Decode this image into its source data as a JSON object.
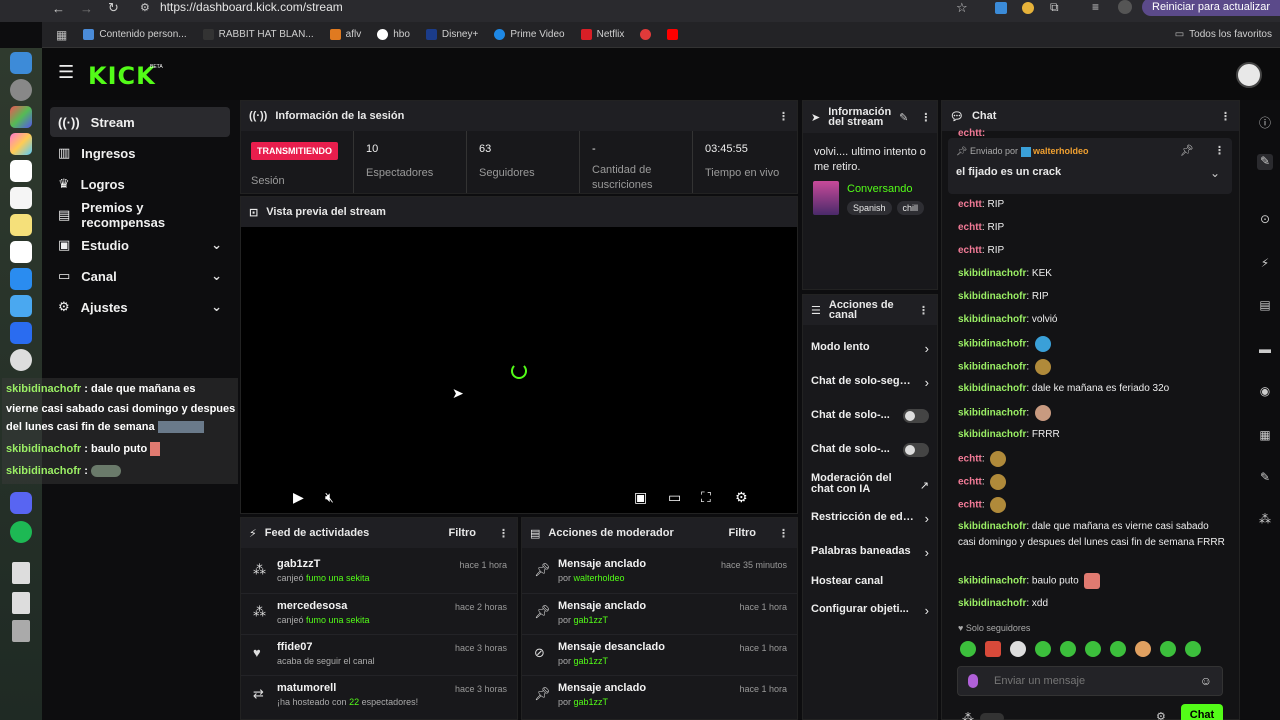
{
  "browser": {
    "url": "https://dashboard.kick.com/stream",
    "restart_label": "Reiniciar para actualizar",
    "bookmarks": [
      "Contenido person...",
      "RABBIT HAT BLAN...",
      "aflv",
      "hbo",
      "Disney+",
      "Prime Video",
      "Netflix"
    ],
    "all_favorites": "Todos los favoritos"
  },
  "brand": {
    "logo": "KICK",
    "beta": "BETA",
    "accent": "#53fc18"
  },
  "sidebar": {
    "items": [
      {
        "label": "Stream",
        "icon": "broadcast-icon",
        "active": true
      },
      {
        "label": "Ingresos",
        "icon": "chart-icon"
      },
      {
        "label": "Logros",
        "icon": "trophy-icon"
      },
      {
        "label": "Premios y recompensas",
        "icon": "gift-icon"
      },
      {
        "label": "Estudio",
        "icon": "monitor-icon",
        "expandable": true
      },
      {
        "label": "Canal",
        "icon": "display-icon",
        "expandable": true
      },
      {
        "label": "Ajustes",
        "icon": "gear-icon",
        "expandable": true
      }
    ]
  },
  "overlay_chat": {
    "lines": [
      {
        "user": "skibidinachofr",
        "text": "dale que mañana es"
      },
      {
        "user": "",
        "text": "vierne casi sabado casi domingo y despues"
      },
      {
        "user": "",
        "text": "del lunes casi fin de semana"
      },
      {
        "user": "skibidinachofr",
        "text": "baulo puto"
      },
      {
        "user": "skibidinachofr",
        "text": ""
      }
    ]
  },
  "session": {
    "title": "Información de la sesión",
    "status": "TRANSMITIENDO",
    "status_label": "Sesión",
    "stats": [
      {
        "value": "10",
        "label": "Espectadores"
      },
      {
        "value": "63",
        "label": "Seguidores"
      },
      {
        "value": "-",
        "label": "Cantidad de suscriciones"
      },
      {
        "value": "03:45:55",
        "label": "Tiempo en vivo"
      }
    ]
  },
  "preview": {
    "title": "Vista previa del stream"
  },
  "stream_info": {
    "title": "Información del stream",
    "stream_title": "volvi.... ultimo intento o me retiro.",
    "category": "Conversando",
    "tags": [
      "Spanish",
      "chill"
    ]
  },
  "channel_actions": {
    "title": "Acciones de canal",
    "items": [
      {
        "label": "Modo lento",
        "type": "chevron"
      },
      {
        "label": "Chat de solo-seguidores",
        "type": "chevron"
      },
      {
        "label": "Chat de solo-...",
        "type": "toggle"
      },
      {
        "label": "Chat de solo-...",
        "type": "toggle"
      },
      {
        "label": "Moderación del chat con IA",
        "type": "external"
      },
      {
        "label": "Restricción de edad",
        "type": "chevron"
      },
      {
        "label": "Palabras baneadas",
        "type": "chevron"
      },
      {
        "label": "Hostear canal",
        "type": "none"
      },
      {
        "label": "Configurar objeti...",
        "type": "chevron"
      }
    ]
  },
  "activity_feed": {
    "title": "Feed de actividades",
    "filter": "Filtro",
    "rows": [
      {
        "name": "gab1zzT",
        "pre": "canjeó ",
        "highlight": "fumo una sekita",
        "post": "",
        "time": "hace 1 hora",
        "icon": "redeem-icon"
      },
      {
        "name": "mercedesosa",
        "pre": "canjeó ",
        "highlight": "fumo una sekita",
        "post": "",
        "time": "hace 2 horas",
        "icon": "redeem-icon"
      },
      {
        "name": "ffide07",
        "pre": "acaba de seguir el canal",
        "highlight": "",
        "post": "",
        "time": "hace 3 horas",
        "icon": "heart-icon"
      },
      {
        "name": "matumorell",
        "pre": "¡ha hosteado con ",
        "highlight": "22",
        "post": " espectadores!",
        "time": "hace 3 horas",
        "icon": "host-icon"
      }
    ]
  },
  "mod_actions": {
    "title": "Acciones de moderador",
    "filter": "Filtro",
    "rows": [
      {
        "action": "Mensaje anclado",
        "by": "por ",
        "user": "walterholdeo",
        "time": "hace 35 minutos",
        "icon": "pin-icon"
      },
      {
        "action": "Mensaje anclado",
        "by": "por ",
        "user": "gab1zzT",
        "time": "hace 1 hora",
        "icon": "pin-icon"
      },
      {
        "action": "Mensaje desanclado",
        "by": "por ",
        "user": "gab1zzT",
        "time": "hace 1 hora",
        "icon": "unpin-icon"
      },
      {
        "action": "Mensaje anclado",
        "by": "por ",
        "user": "gab1zzT",
        "time": "hace 1 hora",
        "icon": "pin-icon"
      }
    ]
  },
  "chat": {
    "title": "Chat",
    "pinned": {
      "sent_by": "Enviado por",
      "user": "walterholdeo",
      "message": "el fijado es un crack"
    },
    "top_partial_user": "echtt:",
    "messages": [
      {
        "user": "echtt",
        "color": "p",
        "text": "RIP"
      },
      {
        "user": "echtt",
        "color": "p",
        "text": "RIP"
      },
      {
        "user": "echtt",
        "color": "p",
        "text": "RIP"
      },
      {
        "user": "skibidinachofr",
        "color": "g",
        "text": "KEK"
      },
      {
        "user": "skibidinachofr",
        "color": "g",
        "text": "RIP"
      },
      {
        "user": "skibidinachofr",
        "color": "g",
        "text": "volvió"
      },
      {
        "user": "skibidinachofr",
        "color": "g",
        "text": "",
        "emote": "#3aa0d8"
      },
      {
        "user": "skibidinachofr",
        "color": "g",
        "text": "",
        "emote": "#b08a3a"
      },
      {
        "user": "skibidinachofr",
        "color": "g",
        "text": "dale ke mañana es feriado 32o"
      },
      {
        "user": "skibidinachofr",
        "color": "g",
        "text": "",
        "emote": "#c89a80"
      },
      {
        "user": "skibidinachofr",
        "color": "g",
        "text": "FRRR"
      },
      {
        "user": "echtt",
        "color": "p",
        "text": "",
        "emote": "#b08a3a"
      },
      {
        "user": "echtt",
        "color": "p",
        "text": "",
        "emote": "#b08a3a"
      },
      {
        "user": "echtt",
        "color": "p",
        "text": "",
        "emote": "#b08a3a"
      }
    ],
    "long_message": {
      "user": "skibidinachofr",
      "text": "dale que mañana es vierne casi sabado casi domingo y despues del lunes casi fin de semana FRRR"
    },
    "tail": [
      {
        "user": "skibidinachofr",
        "text": "baulo puto",
        "emote": "#e07a70"
      },
      {
        "user": "skibidinachofr",
        "text": "xdd"
      }
    ],
    "followers_only": "Solo seguidores",
    "input_placeholder": "Enviar un mensaje",
    "send_label": "Chat"
  }
}
